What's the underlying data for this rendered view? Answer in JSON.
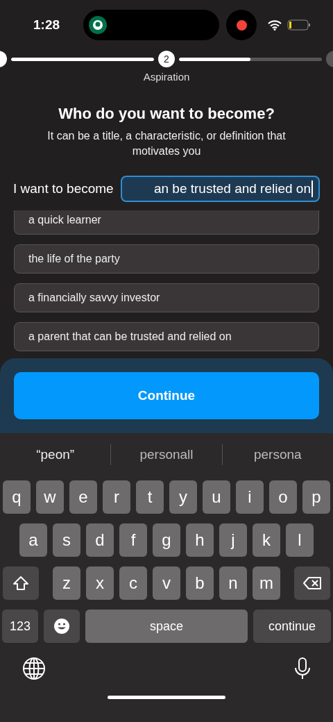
{
  "status_bar": {
    "time": "1:28",
    "recording": true
  },
  "stepper": {
    "segments": [
      {
        "level": 1
      },
      {
        "level": 0.5
      }
    ],
    "current_step": {
      "number": "2",
      "label": "Aspiration"
    }
  },
  "heading": {
    "title": "Who do you want to become?",
    "subtitle": "It can be a title, a characteristic, or definition that motivates you"
  },
  "input": {
    "label": "I want to become",
    "value": "an be trusted and relied on",
    "focused": true
  },
  "suggestions": [
    "a quick learner",
    "the life of the party",
    "a financially savvy investor",
    "a parent that can be trusted and relied on"
  ],
  "continue_button": "Continue",
  "keyboard": {
    "predictions": [
      "“peon”",
      "personall",
      "persona"
    ],
    "rows": [
      [
        "q",
        "w",
        "e",
        "r",
        "t",
        "y",
        "u",
        "i",
        "o",
        "p"
      ],
      [
        "a",
        "s",
        "d",
        "f",
        "g",
        "h",
        "j",
        "k",
        "l"
      ],
      [
        "z",
        "x",
        "c",
        "v",
        "b",
        "n",
        "m"
      ]
    ],
    "numbers_key": "123",
    "space_key": "space",
    "return_key": "continue"
  }
}
